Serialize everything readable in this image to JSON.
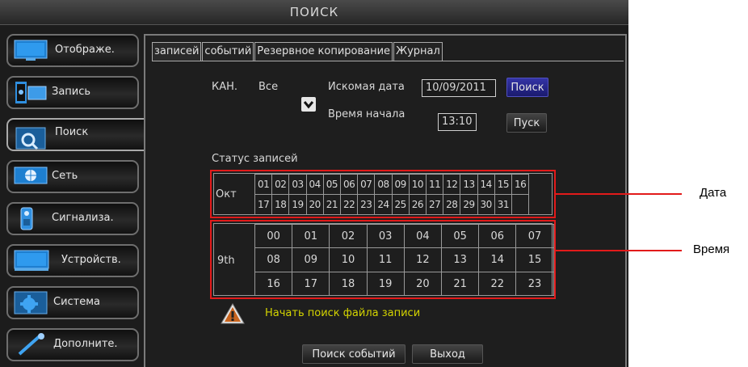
{
  "title": "ПОИСК",
  "sidebar": {
    "items": [
      {
        "label": "Отображе.",
        "icon": "monitor-icon"
      },
      {
        "label": "Запись",
        "icon": "film-icon"
      },
      {
        "label": "Поиск",
        "icon": "magnifier-icon",
        "active": true
      },
      {
        "label": "Сеть",
        "icon": "network-icon"
      },
      {
        "label": "Сигнализа.",
        "icon": "alarm-icon"
      },
      {
        "label": "Устройств.",
        "icon": "device-icon"
      },
      {
        "label": "Система",
        "icon": "gear-icon"
      },
      {
        "label": "Дополните.",
        "icon": "wrench-icon"
      }
    ]
  },
  "tabs": [
    "записей",
    "событий",
    "Резервное копирование",
    "Журнал"
  ],
  "filters": {
    "channel_label": "КАН.",
    "channel_value": "Все",
    "date_label": "Искомая дата",
    "date_value": "10/09/2011",
    "search_button": "Поиск",
    "start_time_label": "Время начала",
    "start_time_value": "13:10",
    "play_button": "Пуск"
  },
  "status": {
    "title": "Статус записей",
    "month": "Окт",
    "days": [
      "01",
      "02",
      "03",
      "04",
      "05",
      "06",
      "07",
      "08",
      "09",
      "10",
      "11",
      "12",
      "13",
      "14",
      "15",
      "16",
      "17",
      "18",
      "19",
      "20",
      "21",
      "22",
      "23",
      "24",
      "25",
      "26",
      "27",
      "28",
      "29",
      "30",
      "31",
      ""
    ],
    "day_label": "9th",
    "hours": [
      "00",
      "01",
      "02",
      "03",
      "04",
      "05",
      "06",
      "07",
      "08",
      "09",
      "10",
      "11",
      "12",
      "13",
      "14",
      "15",
      "16",
      "17",
      "18",
      "19",
      "20",
      "21",
      "22",
      "23"
    ]
  },
  "message": "Начать поиск файла записи",
  "bottom_buttons": {
    "event_search": "Поиск событий",
    "exit": "Выход"
  },
  "callouts": {
    "date": "Дата",
    "time": "Время"
  },
  "colors": {
    "highlight": "#e21a1a",
    "message": "#d4d400",
    "search_button": "#2a2a8a"
  }
}
